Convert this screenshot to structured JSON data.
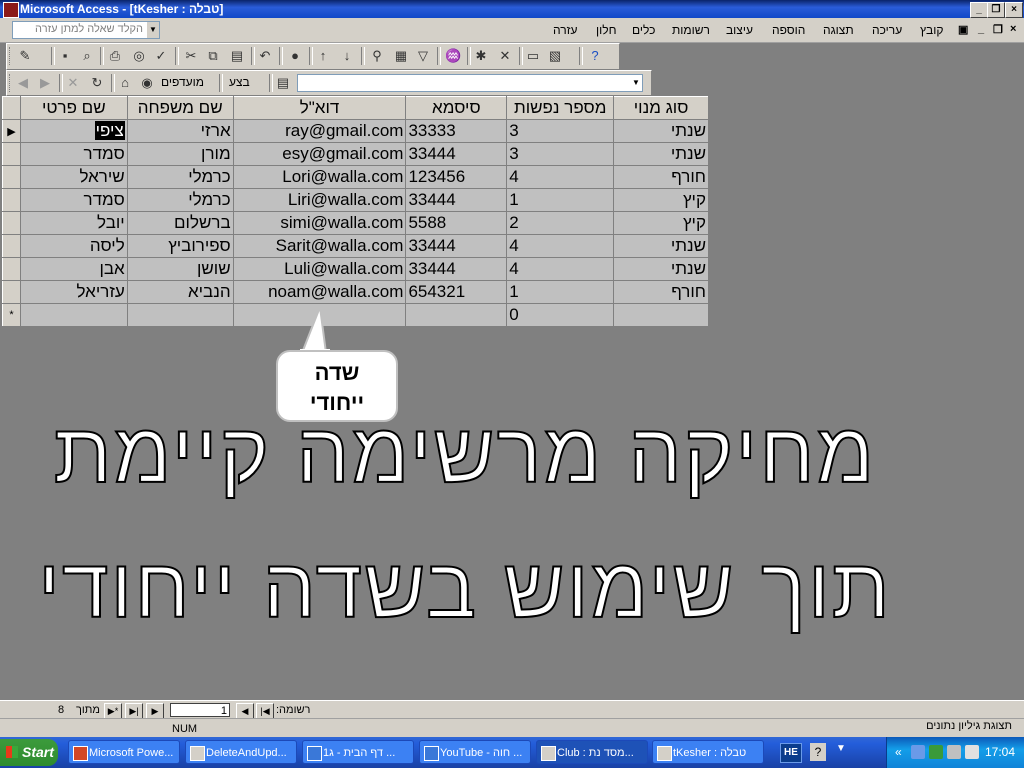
{
  "window": {
    "title": "Microsoft Access - [tKesher : טבלה]"
  },
  "menubar": {
    "ask_placeholder": "הקלד שאלה למתן עזרה",
    "items": [
      "קובץ",
      "עריכה",
      "תצוגה",
      "הוספה",
      "עיצוב",
      "רשומות",
      "כלים",
      "חלון",
      "עזרה"
    ]
  },
  "toolbar2": {
    "records_label": "מועדפים",
    "go_label": "בצע"
  },
  "table": {
    "columns": [
      "סוג מנוי",
      "מספר נפשות",
      "סיסמא",
      "דוא\"ל",
      "שם משפחה",
      "שם פרטי"
    ],
    "rows": [
      [
        "שנתי",
        "3",
        "33333",
        "ray@gmail.com",
        "ארזי",
        "ציפי"
      ],
      [
        "שנתי",
        "3",
        "33444",
        "esy@gmail.com",
        "מורן",
        "סמדר"
      ],
      [
        "חורף",
        "4",
        "123456",
        "Lori@walla.com",
        "כרמלי",
        "שיראל"
      ],
      [
        "קיץ",
        "1",
        "33444",
        "Liri@walla.com",
        "כרמלי",
        "סמדר"
      ],
      [
        "קיץ",
        "2",
        "5588",
        "simi@walla.com",
        "ברשלום",
        "יובל"
      ],
      [
        "שנתי",
        "4",
        "33444",
        "Sarit@walla.com",
        "ספירוביץ",
        "ליסה"
      ],
      [
        "שנתי",
        "4",
        "33444",
        "Luli@walla.com",
        "שושן",
        "אבן"
      ],
      [
        "חורף",
        "1",
        "654321",
        "noam@walla.com",
        "הנביא",
        "עזריאל"
      ]
    ],
    "new_row_default": "0"
  },
  "callout": {
    "line1": "שדה",
    "line2": "ייחודי"
  },
  "overlay": {
    "line1": "מחיקה מרשימה קיימת",
    "line2": "תוך שימוש בשדה ייחודי"
  },
  "record_nav": {
    "label": "רשומה:",
    "current": "1",
    "of_label": "מתוך",
    "total": "8"
  },
  "statusbar": {
    "view": "תצוגת גיליון נתונים",
    "num": "NUM"
  },
  "taskbar": {
    "start": "Start",
    "buttons": [
      "Microsoft Powe...",
      "DeleteAndUpd...",
      "דף הבית - ג1 ...",
      "YouTube - חוה ...",
      "Club : מסד נת...",
      "tKesher : טבלה"
    ],
    "lang": "HE",
    "time": "17:04"
  },
  "colors": {
    "titlebar": "#0a246a",
    "background": "#808080",
    "datasheet": "#c0c0c0"
  }
}
